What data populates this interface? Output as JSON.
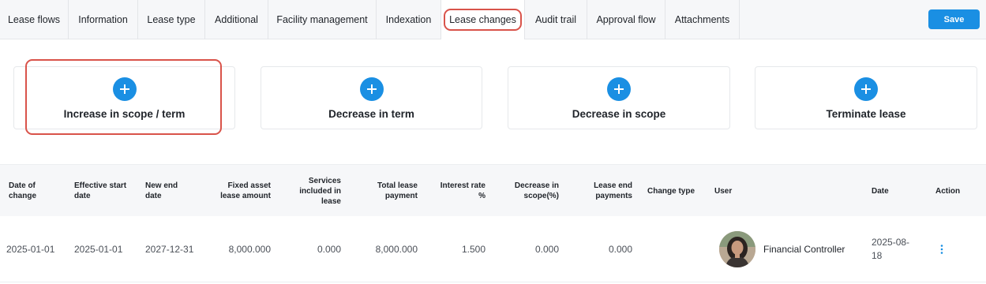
{
  "tabs": [
    {
      "label": "Lease flows"
    },
    {
      "label": "Information"
    },
    {
      "label": "Lease type"
    },
    {
      "label": "Additional"
    },
    {
      "label": "Facility management"
    },
    {
      "label": "Indexation"
    },
    {
      "label": "Lease changes",
      "active": true
    },
    {
      "label": "Audit trail"
    },
    {
      "label": "Approval flow"
    },
    {
      "label": "Attachments"
    }
  ],
  "save_label": "Save",
  "accent_color": "#1a8fe3",
  "highlight_color": "#d9534a",
  "cards": [
    {
      "label": "Increase in scope / term",
      "icon": "plus-circle-icon"
    },
    {
      "label": "Decrease in term",
      "icon": "plus-circle-icon"
    },
    {
      "label": "Decrease in scope",
      "icon": "plus-circle-icon"
    },
    {
      "label": "Terminate lease",
      "icon": "plus-circle-icon"
    }
  ],
  "table": {
    "headers": {
      "date_of_change": "Date of change",
      "effective_start_date": "Effective start date",
      "new_end_date": "New end date",
      "fixed_asset_lease_amount": "Fixed asset lease amount",
      "services_included": "Services included in lease",
      "total_lease_payment": "Total lease payment",
      "interest_rate": "Interest rate %",
      "decrease_in_scope": "Decrease in scope(%)",
      "lease_end_payments": "Lease end payments",
      "change_type": "Change type",
      "user": "User",
      "date": "Date",
      "action": "Action"
    },
    "rows": [
      {
        "date_of_change": "2025-01-01",
        "effective_start_date": "2025-01-01",
        "new_end_date": "2027-12-31",
        "fixed_asset_lease_amount": "8,000.000",
        "services_included": "0.000",
        "total_lease_payment": "8,000.000",
        "interest_rate": "1.500",
        "decrease_in_scope": "0.000",
        "lease_end_payments": "0.000",
        "change_type": "",
        "user": "Financial Controller",
        "date_line1": "2025-08-",
        "date_line2": "18",
        "action_icon": "kebab-menu-icon"
      }
    ]
  }
}
